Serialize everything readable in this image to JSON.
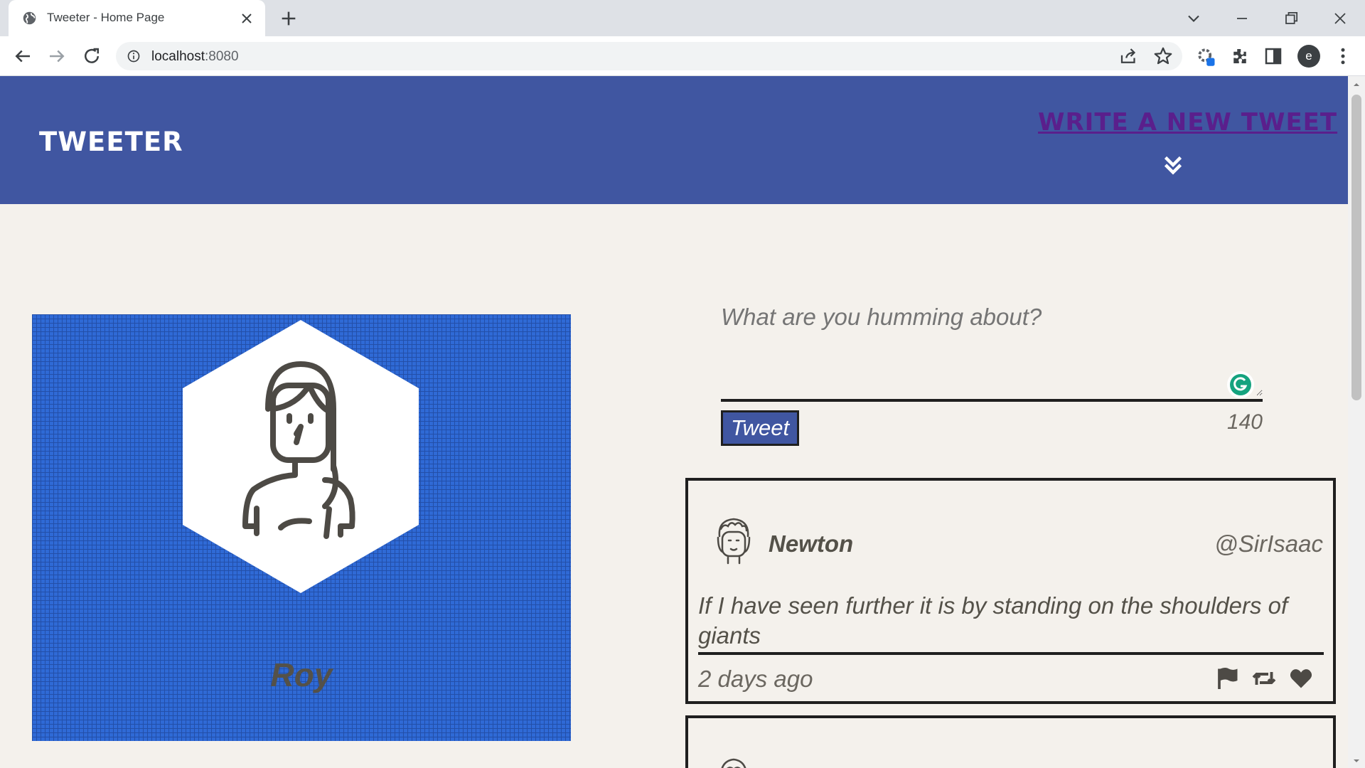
{
  "browser": {
    "tab_title": "Tweeter - Home Page",
    "url_host": "localhost",
    "url_port": ":8080",
    "profile_initial": "e"
  },
  "site": {
    "brand": "Tweeter",
    "compose_link": "Write a new tweet",
    "colors": {
      "nav": "#4056a1",
      "background": "#f4f1ec",
      "text": "#545149",
      "link": "#5a1f8c"
    }
  },
  "profile": {
    "name": "Roy",
    "avatar_icon": "girl-avatar-icon"
  },
  "composer": {
    "placeholder": "What are you humming about?",
    "button_label": "Tweet",
    "counter": "140"
  },
  "tweets": [
    {
      "name": "Newton",
      "handle": "@SirIsaac",
      "text": "If I have seen further it is by standing on the shoulders of giants",
      "time": "2 days ago",
      "actions": [
        "flag-icon",
        "retweet-icon",
        "heart-icon"
      ]
    }
  ]
}
